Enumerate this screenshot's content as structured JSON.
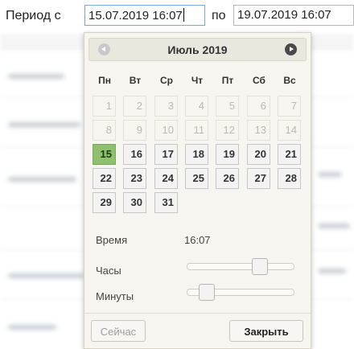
{
  "filter": {
    "period_label": "Период с",
    "from_value": "15.07.2019 16:07",
    "to_label": "по",
    "to_value": "19.07.2019 16:07"
  },
  "picker": {
    "month_title": "Июль 2019",
    "prev_icon": "prev-month-icon",
    "next_icon": "next-month-icon",
    "weekdays": [
      "Пн",
      "Вт",
      "Ср",
      "Чт",
      "Пт",
      "Сб",
      "Вс"
    ],
    "weeks": [
      [
        {
          "d": "1",
          "s": "disabled"
        },
        {
          "d": "2",
          "s": "disabled"
        },
        {
          "d": "3",
          "s": "disabled"
        },
        {
          "d": "4",
          "s": "disabled"
        },
        {
          "d": "5",
          "s": "disabled"
        },
        {
          "d": "6",
          "s": "disabled"
        },
        {
          "d": "7",
          "s": "disabled"
        }
      ],
      [
        {
          "d": "8",
          "s": "disabled"
        },
        {
          "d": "9",
          "s": "disabled"
        },
        {
          "d": "10",
          "s": "disabled"
        },
        {
          "d": "11",
          "s": "disabled"
        },
        {
          "d": "12",
          "s": "disabled"
        },
        {
          "d": "13",
          "s": "disabled"
        },
        {
          "d": "14",
          "s": "disabled"
        }
      ],
      [
        {
          "d": "15",
          "s": "today"
        },
        {
          "d": "16",
          "s": "active"
        },
        {
          "d": "17",
          "s": "active"
        },
        {
          "d": "18",
          "s": "active"
        },
        {
          "d": "19",
          "s": "active"
        },
        {
          "d": "20",
          "s": "active"
        },
        {
          "d": "21",
          "s": "active"
        }
      ],
      [
        {
          "d": "22",
          "s": "active"
        },
        {
          "d": "23",
          "s": "active"
        },
        {
          "d": "24",
          "s": "active"
        },
        {
          "d": "25",
          "s": "active"
        },
        {
          "d": "26",
          "s": "active"
        },
        {
          "d": "27",
          "s": "active"
        },
        {
          "d": "28",
          "s": "active"
        }
      ],
      [
        {
          "d": "29",
          "s": "active"
        },
        {
          "d": "30",
          "s": "active"
        },
        {
          "d": "31",
          "s": "active"
        }
      ]
    ],
    "time_label": "Время",
    "time_value": "16:07",
    "hours_label": "Часы",
    "hours_fraction": 0.7,
    "minutes_label": "Минуты",
    "minutes_fraction": 0.12,
    "now_button": "Сейчас",
    "close_button": "Закрыть"
  },
  "colors": {
    "today_highlight": "#8fc06d",
    "picker_background": "#f6f5ef",
    "focused_input_border": "#7ea6d6"
  }
}
